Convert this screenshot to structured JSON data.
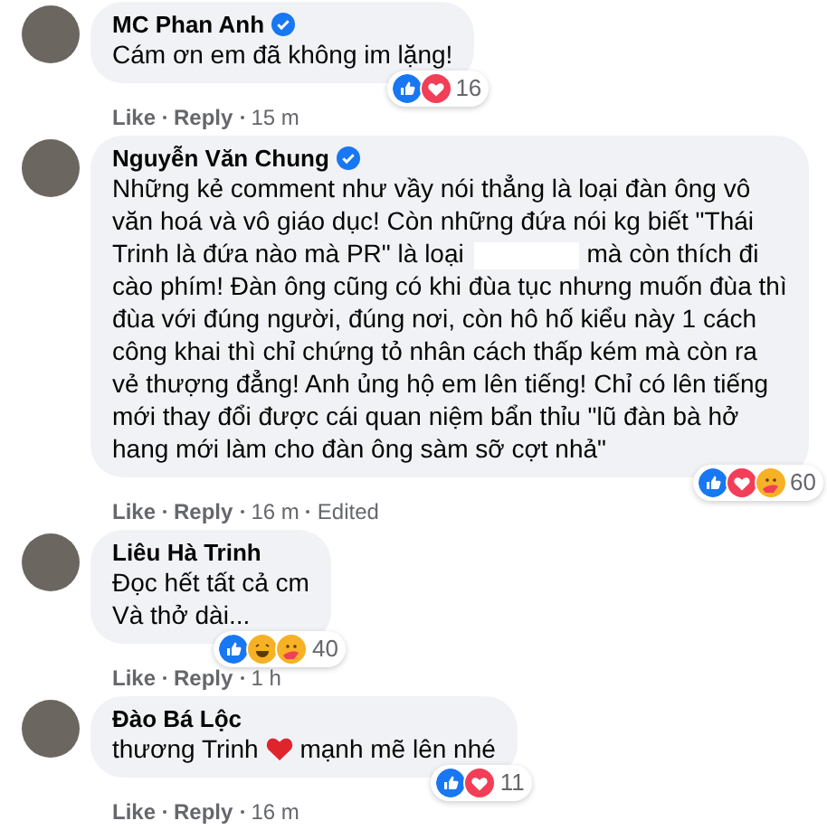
{
  "comments": [
    {
      "author": "MC Phan Anh",
      "verified": true,
      "parts": [
        {
          "kind": "text",
          "text": "Cám ơn em đã không im lặng!"
        }
      ],
      "reactions": [
        {
          "kind": "like"
        },
        {
          "kind": "love"
        }
      ],
      "count": "16",
      "actions": [
        "Like",
        "Reply"
      ],
      "time": "15 m"
    },
    {
      "author": "Nguyễn Văn Chung",
      "verified": true,
      "parts": [
        {
          "kind": "text",
          "text": "Những kẻ comment như vầy nói thẳng là loại đàn ông vô văn hoá và vô giáo dục! Còn những đứa nói kg biết \"Thái Trinh là đứa nào mà PR\" là loại"
        },
        {
          "kind": "redaction"
        },
        {
          "kind": "text",
          "text": "mà còn thích đi cào phím! Đàn ông cũng có khi đùa tục nhưng muốn đùa thì đùa với đúng người, đúng nơi, còn hô hố kiểu này 1 cách công khai thì chỉ chứng tỏ nhân cách thấp kém mà còn ra vẻ thượng đẳng! Anh ủng hộ em lên tiếng! Chỉ có lên tiếng mới thay đổi được cái quan niệm bẩn thỉu \"lũ đàn bà hở hang mới làm cho đàn ông sàm sỡ cợt nhả\""
        }
      ],
      "reactions": [
        {
          "kind": "like"
        },
        {
          "kind": "love"
        },
        {
          "kind": "care"
        }
      ],
      "count": "60",
      "actions": [
        "Like",
        "Reply"
      ],
      "time": "16 m",
      "edited": "Edited"
    },
    {
      "author": "Liêu Hà Trinh",
      "verified": false,
      "parts": [
        {
          "kind": "text",
          "text": "Đọc hết tất cả cm"
        },
        {
          "kind": "break"
        },
        {
          "kind": "text",
          "text": "Và thở dài..."
        }
      ],
      "reactions": [
        {
          "kind": "like"
        },
        {
          "kind": "haha"
        },
        {
          "kind": "care"
        }
      ],
      "count": "40",
      "actions": [
        "Like",
        "Reply"
      ],
      "time": "1 h"
    },
    {
      "author": "Đào Bá Lộc",
      "verified": false,
      "parts": [
        {
          "kind": "text",
          "text": "thương Trinh"
        },
        {
          "kind": "heart"
        },
        {
          "kind": "text",
          "text": "mạnh mẽ lên nhé"
        }
      ],
      "reactions": [
        {
          "kind": "like"
        },
        {
          "kind": "love"
        }
      ],
      "count": "11",
      "actions": [
        "Like",
        "Reply"
      ],
      "time": "16 m"
    }
  ]
}
